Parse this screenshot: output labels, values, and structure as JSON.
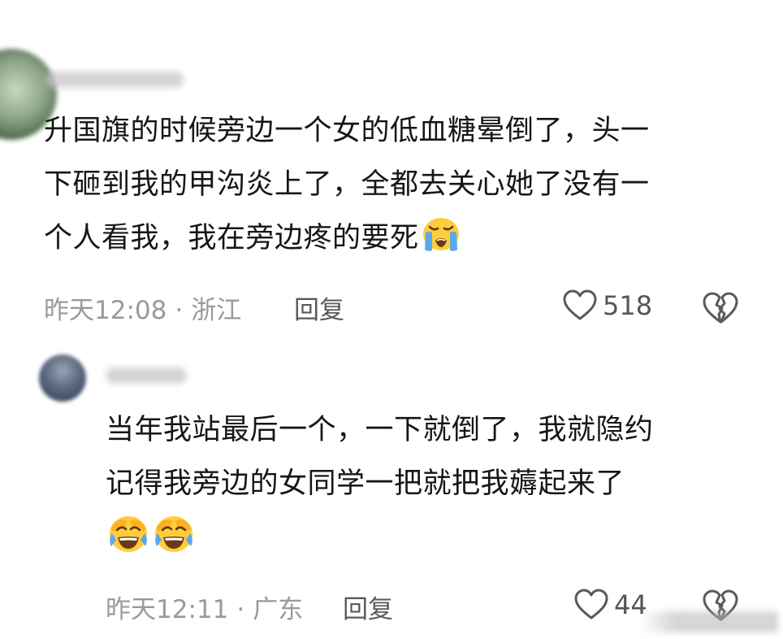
{
  "comments": [
    {
      "text_lines": [
        "升国旗的时候旁边一个女的低血糖晕倒了，头一",
        "下砸到我的甲沟炎上了，全都去关心她了没有一",
        "个人看我，我在旁边疼的要死"
      ],
      "emoji": "loudly-crying-face",
      "time": "昨天12:08",
      "separator": "·",
      "location": "浙江",
      "reply_label": "回复",
      "likes": "518"
    },
    {
      "text_lines": [
        "当年我站最后一个，一下就倒了，我就隐约",
        "记得我旁边的女同学一把就把我薅起来了"
      ],
      "emoji": "face-with-tears-of-joy-facepalm",
      "time": "昨天12:11",
      "separator": "·",
      "location": "广东",
      "reply_label": "回复",
      "likes": "44"
    }
  ],
  "colors": {
    "text": "#161616",
    "meta": "#9a9a9a",
    "reply": "#5a5a5a"
  }
}
